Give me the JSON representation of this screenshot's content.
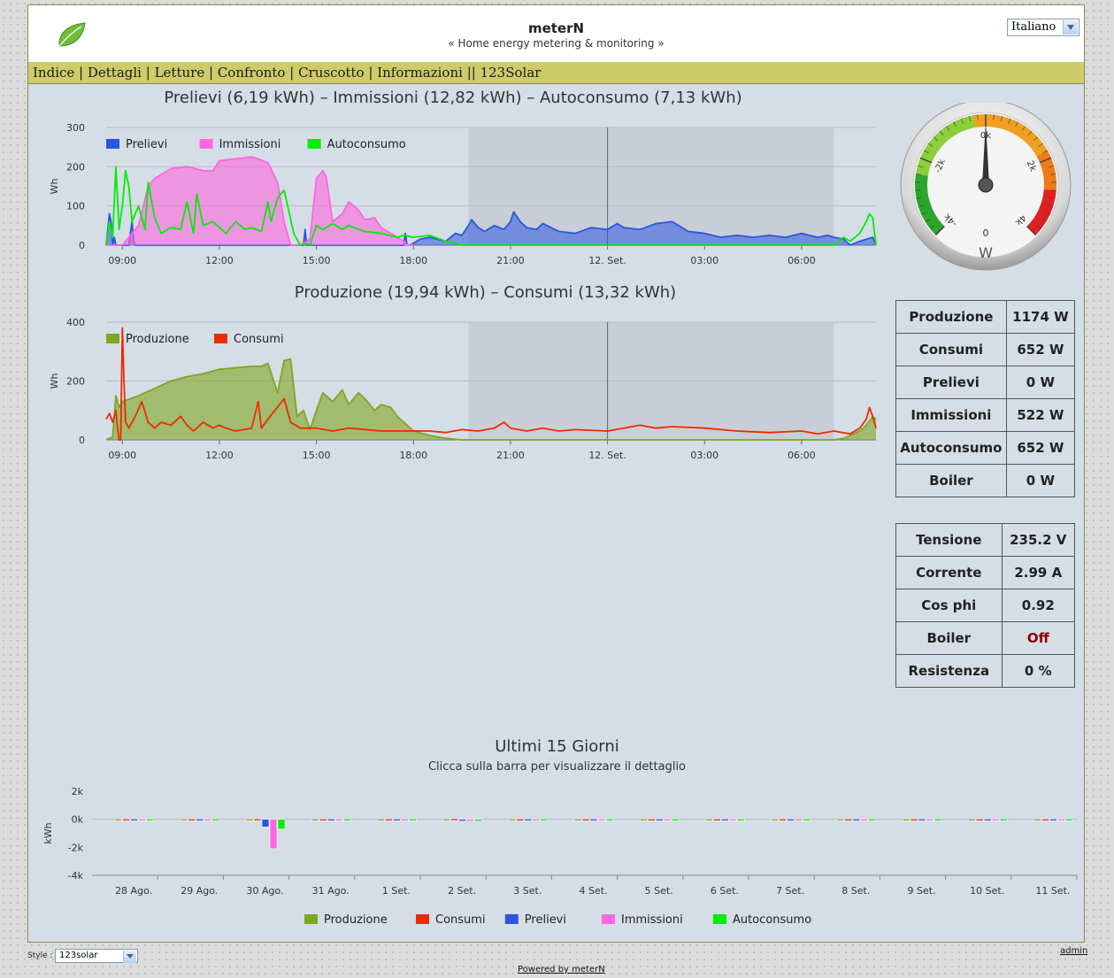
{
  "header": {
    "title": "meterN",
    "subtitle": "« Home energy metering & monitoring »",
    "language": "Italiano"
  },
  "menu": {
    "items": [
      "Indice",
      "Dettagli",
      "Letture",
      "Confronto",
      "Cruscotto",
      "Informazioni"
    ],
    "extra": "123Solar"
  },
  "colors": {
    "prelievi": "#2b55e0",
    "immissioni": "#ff66e0",
    "autoconsumo": "#00ee00",
    "produzione": "#7fa61f",
    "consumi": "#ee2a00"
  },
  "chart1": {
    "title": "Prelievi (6,19 kWh) – Immissioni (12,82 kWh) – Autoconsumo (7,13 kWh)",
    "ylabel": "Wh",
    "legend": [
      "Prelievi",
      "Immissioni",
      "Autoconsumo"
    ]
  },
  "chart2": {
    "title": "Produzione (19,94 kWh) – Consumi (13,32 kWh)",
    "ylabel": "Wh",
    "legend": [
      "Produzione",
      "Consumi"
    ]
  },
  "chart3": {
    "title": "Ultimi 15 Giorni",
    "subtitle": "Clicca sulla barra per visualizzare il dettaglio",
    "ylabel": "kWh",
    "legend": [
      "Produzione",
      "Consumi",
      "Prelievi",
      "Immissioni",
      "Autoconsumo"
    ]
  },
  "chart_data": [
    {
      "type": "area",
      "title": "Prelievi (6,19 kWh) – Immissioni (12,82 kWh) – Autoconsumo (7,13 kWh)",
      "ylabel": "Wh",
      "ylim": [
        0,
        300
      ],
      "yticks": [
        "0",
        "100",
        "200",
        "300"
      ],
      "xticks": [
        "09:00",
        "12:00",
        "15:00",
        "18:00",
        "21:00",
        "12. Set.",
        "03:00",
        "06:00"
      ],
      "xtick_hours": [
        9,
        12,
        15,
        18,
        21,
        24,
        27,
        30
      ],
      "xlim_hours": [
        8.5,
        32.3
      ],
      "night_band_hours": [
        19.7,
        31.0
      ],
      "grid": true,
      "legend": "top-left",
      "series": [
        {
          "name": "Prelievi",
          "x": [
            8.5,
            8.6,
            8.65,
            8.7,
            8.75,
            8.8,
            8.9,
            9.0,
            9.2,
            9.3,
            9.35,
            9.4,
            9.5,
            10,
            12,
            14,
            14.6,
            14.65,
            14.7,
            14.8,
            17.5,
            17.7,
            17.75,
            17.8,
            17.9,
            18.0,
            18.2,
            18.5,
            19.0,
            19.3,
            19.5,
            19.7,
            19.8,
            20.0,
            20.2,
            20.5,
            20.8,
            21.0,
            21.1,
            21.3,
            21.5,
            21.8,
            22.0,
            22.5,
            23.0,
            23.5,
            24.0,
            24.3,
            24.5,
            25.0,
            25.5,
            26.0,
            26.5,
            27.0,
            27.5,
            28.0,
            28.5,
            29.0,
            29.5,
            30.0,
            30.5,
            30.8,
            31.0,
            31.3,
            31.5,
            31.8,
            32.0,
            32.2,
            32.3
          ],
          "y": [
            0,
            80,
            60,
            0,
            20,
            0,
            0,
            0,
            0,
            60,
            10,
            0,
            0,
            0,
            0,
            0,
            0,
            40,
            0,
            0,
            0,
            0,
            30,
            0,
            0,
            5,
            15,
            20,
            10,
            30,
            25,
            50,
            65,
            45,
            35,
            50,
            40,
            60,
            85,
            60,
            45,
            40,
            55,
            35,
            30,
            45,
            40,
            55,
            45,
            40,
            55,
            60,
            35,
            30,
            20,
            25,
            20,
            25,
            20,
            30,
            20,
            25,
            20,
            15,
            0,
            10,
            15,
            20,
            0
          ]
        },
        {
          "name": "Immissioni",
          "x": [
            8.5,
            8.8,
            9.0,
            9.3,
            9.5,
            9.8,
            10.0,
            10.2,
            10.5,
            11.0,
            11.5,
            11.8,
            12.0,
            12.5,
            13.0,
            13.2,
            13.5,
            13.8,
            14.0,
            14.2,
            14.5,
            14.8,
            15.0,
            15.2,
            15.3,
            15.5,
            15.8,
            16.0,
            16.3,
            16.5,
            16.8,
            17.0,
            17.3,
            17.5,
            17.7,
            17.8,
            18.0
          ],
          "y": [
            0,
            0,
            0,
            30,
            50,
            150,
            170,
            180,
            195,
            200,
            190,
            190,
            215,
            220,
            225,
            220,
            210,
            160,
            60,
            0,
            0,
            15,
            170,
            190,
            175,
            60,
            80,
            110,
            90,
            65,
            70,
            45,
            30,
            20,
            10,
            0,
            0
          ]
        },
        {
          "name": "Autoconsumo",
          "x": [
            8.5,
            8.6,
            8.7,
            8.8,
            8.9,
            9.0,
            9.1,
            9.2,
            9.3,
            9.4,
            9.5,
            9.7,
            9.8,
            10.0,
            10.2,
            10.5,
            10.8,
            11.0,
            11.2,
            11.3,
            11.5,
            11.8,
            12.0,
            12.2,
            12.5,
            12.8,
            13.0,
            13.3,
            13.5,
            13.6,
            13.8,
            14.0,
            14.3,
            14.5,
            14.7,
            14.8,
            15.0,
            15.2,
            15.3,
            15.5,
            15.8,
            16.0,
            16.3,
            16.5,
            17.0,
            17.5,
            17.7,
            18.0,
            18.5,
            19.0,
            19.3,
            19.5,
            20.0,
            21.0,
            24.0,
            27.0,
            30.0,
            31.0,
            31.3,
            31.5,
            31.8,
            32.0,
            32.1,
            32.2,
            32.3
          ],
          "y": [
            0,
            60,
            20,
            200,
            40,
            100,
            190,
            150,
            60,
            80,
            100,
            40,
            160,
            70,
            30,
            45,
            40,
            110,
            30,
            130,
            50,
            60,
            45,
            30,
            60,
            40,
            45,
            35,
            110,
            60,
            120,
            140,
            30,
            0,
            5,
            0,
            50,
            40,
            45,
            55,
            40,
            50,
            40,
            35,
            30,
            20,
            25,
            20,
            25,
            10,
            5,
            0,
            0,
            0,
            0,
            0,
            0,
            0,
            20,
            10,
            30,
            60,
            80,
            70,
            0
          ]
        }
      ]
    },
    {
      "type": "area",
      "title": "Produzione (19,94 kWh) – Consumi (13,32 kWh)",
      "ylabel": "Wh",
      "ylim": [
        0,
        400
      ],
      "yticks": [
        "0",
        "200",
        "400"
      ],
      "xticks": [
        "09:00",
        "12:00",
        "15:00",
        "18:00",
        "21:00",
        "12. Set.",
        "03:00",
        "06:00"
      ],
      "xtick_hours": [
        9,
        12,
        15,
        18,
        21,
        24,
        27,
        30
      ],
      "xlim_hours": [
        8.5,
        32.3
      ],
      "night_band_hours": [
        19.7,
        31.0
      ],
      "grid": true,
      "legend": "top-left",
      "series": [
        {
          "name": "Produzione",
          "x": [
            8.5,
            8.7,
            8.8,
            8.9,
            9.0,
            9.5,
            10,
            10.5,
            11,
            11.5,
            12,
            12.5,
            13.0,
            13.2,
            13.3,
            13.5,
            13.8,
            14.0,
            14.2,
            14.4,
            14.6,
            14.8,
            15.0,
            15.2,
            15.5,
            15.8,
            16.0,
            16.3,
            16.5,
            16.8,
            17.0,
            17.3,
            17.5,
            17.8,
            18.0,
            18.5,
            19.0,
            19.5,
            20.0,
            21.0,
            24.0,
            27.0,
            30.0,
            31.0,
            31.3,
            31.5,
            31.8,
            32.0,
            32.2,
            32.3
          ],
          "y": [
            0,
            10,
            150,
            110,
            130,
            150,
            175,
            200,
            215,
            225,
            240,
            245,
            250,
            250,
            250,
            260,
            160,
            270,
            275,
            80,
            100,
            35,
            100,
            160,
            130,
            170,
            120,
            160,
            140,
            100,
            120,
            110,
            80,
            50,
            30,
            15,
            5,
            0,
            0,
            0,
            0,
            0,
            0,
            0,
            5,
            15,
            30,
            50,
            80,
            70
          ]
        },
        {
          "name": "Consumi",
          "x": [
            8.5,
            8.6,
            8.7,
            8.8,
            8.85,
            8.9,
            8.95,
            9.0,
            9.05,
            9.1,
            9.2,
            9.4,
            9.6,
            9.8,
            10.0,
            10.2,
            10.5,
            10.8,
            11.0,
            11.2,
            11.5,
            11.8,
            12.0,
            12.2,
            12.5,
            13.0,
            13.2,
            13.3,
            13.5,
            14.0,
            14.2,
            14.5,
            15.0,
            15.5,
            16.0,
            17.0,
            18.0,
            18.5,
            19.0,
            19.5,
            20.0,
            20.5,
            20.8,
            21.0,
            21.5,
            22.0,
            22.5,
            23.0,
            24.0,
            24.5,
            25.0,
            25.5,
            26.0,
            27.0,
            28.0,
            29.0,
            30.0,
            30.5,
            31.0,
            31.5,
            31.8,
            32.0,
            32.1,
            32.2,
            32.3
          ],
          "y": [
            70,
            90,
            60,
            100,
            40,
            0,
            0,
            380,
            200,
            60,
            40,
            80,
            130,
            60,
            40,
            60,
            50,
            80,
            50,
            30,
            60,
            40,
            50,
            40,
            30,
            40,
            130,
            40,
            70,
            140,
            60,
            40,
            40,
            30,
            40,
            30,
            30,
            30,
            25,
            35,
            30,
            40,
            60,
            40,
            30,
            40,
            30,
            35,
            30,
            40,
            50,
            40,
            45,
            40,
            30,
            25,
            30,
            20,
            30,
            20,
            40,
            70,
            110,
            80,
            40
          ]
        }
      ]
    },
    {
      "type": "bar",
      "title": "Ultimi 15 Giorni",
      "subtitle": "Clicca sulla barra per visualizzare il dettaglio",
      "ylabel": "kWh",
      "ylim": [
        -4,
        2
      ],
      "yticks": [
        "-4k",
        "-2k",
        "0k",
        "2k"
      ],
      "legend": "bottom",
      "categories": [
        "28 Ago.",
        "29 Ago.",
        "30 Ago.",
        "31 Ago.",
        "1 Set.",
        "2 Set.",
        "3 Set.",
        "4 Set.",
        "5 Set.",
        "6 Set.",
        "7 Set.",
        "8 Set.",
        "9 Set.",
        "10 Set.",
        "11 Set."
      ],
      "series": [
        {
          "name": "Produzione",
          "values": [
            0.02,
            0.02,
            0.02,
            0.02,
            0.02,
            0.02,
            0.02,
            0.02,
            0.02,
            0.02,
            0.02,
            0.02,
            0.02,
            0.02,
            0.02
          ]
        },
        {
          "name": "Consumi",
          "values": [
            0.02,
            0.02,
            0.03,
            0.02,
            0.02,
            0.05,
            0.02,
            0.02,
            0.02,
            0.02,
            0.02,
            0.02,
            0.02,
            0.02,
            0.02
          ]
        },
        {
          "name": "Prelievi",
          "values": [
            0.02,
            0.02,
            -0.55,
            0.02,
            0.02,
            -0.08,
            0.02,
            0.02,
            0.02,
            0.02,
            0.02,
            0.02,
            0.02,
            0.02,
            0.02
          ]
        },
        {
          "name": "Immissioni",
          "values": [
            0.02,
            0.02,
            -2.1,
            0.02,
            0.02,
            -0.04,
            0.02,
            0.02,
            0.02,
            0.02,
            0.02,
            0.02,
            0.02,
            0.02,
            0.02
          ]
        },
        {
          "name": "Autoconsumo",
          "values": [
            0.02,
            0.02,
            -0.7,
            0.02,
            0.02,
            -0.06,
            0.02,
            0.02,
            0.02,
            0.02,
            0.02,
            0.02,
            0.02,
            0.02,
            0.02
          ]
        }
      ]
    }
  ],
  "gauge": {
    "unit": "W",
    "value_w": 0,
    "min": -4,
    "max": 4,
    "ticks": [
      "-4k",
      "-2k",
      "0k",
      "2k",
      "4k"
    ],
    "zero_label": "0"
  },
  "power_table": [
    {
      "label": "Produzione",
      "value": "1174 W"
    },
    {
      "label": "Consumi",
      "value": "652 W"
    },
    {
      "label": "Prelievi",
      "value": "0 W"
    },
    {
      "label": "Immissioni",
      "value": "522 W"
    },
    {
      "label": "Autoconsumo",
      "value": "652 W"
    },
    {
      "label": "Boiler",
      "value": "0 W"
    }
  ],
  "electrical_table": [
    {
      "label": "Tensione",
      "value": "235.2 V"
    },
    {
      "label": "Corrente",
      "value": "2.99 A"
    },
    {
      "label": "Cos phi",
      "value": "0.92"
    },
    {
      "label": "Boiler",
      "value": "Off"
    },
    {
      "label": "Resistenza",
      "value": "0 %"
    }
  ],
  "footer": {
    "style_label": "Style :",
    "style_value": "123solar",
    "admin": "admin",
    "powered": "Powered by meterN"
  }
}
